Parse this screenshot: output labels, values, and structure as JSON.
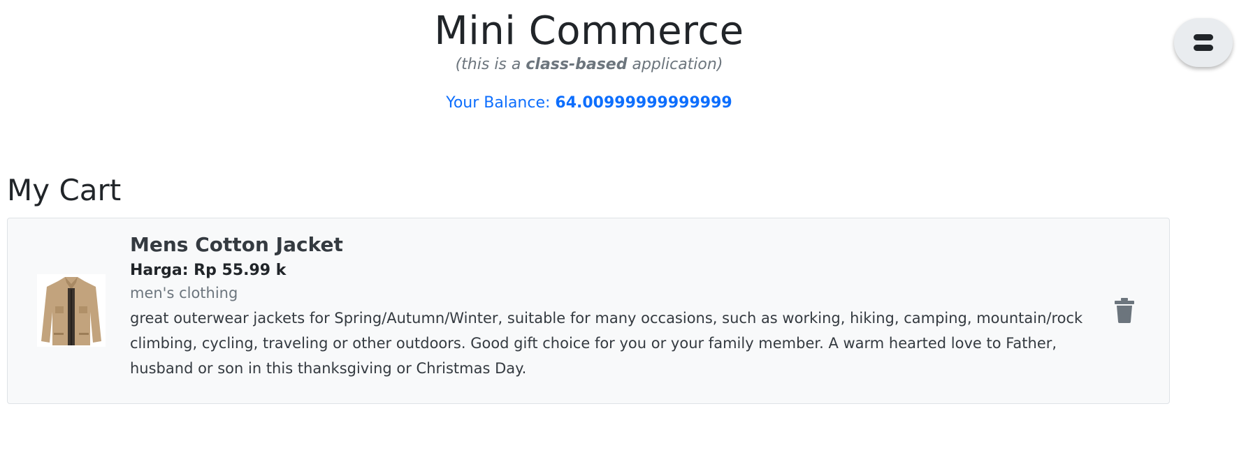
{
  "header": {
    "title": "Mini Commerce",
    "subtitle_prefix": "(this is a ",
    "subtitle_bold": "class-based",
    "subtitle_suffix": " application)",
    "balance_label": "Your Balance: ",
    "balance_value": "64.00999999999999"
  },
  "menu": {
    "icon": "menu-icon"
  },
  "cart": {
    "title": "My Cart",
    "items": [
      {
        "name": "Mens Cotton Jacket",
        "price": "Harga: Rp 55.99 k",
        "category": "men's clothing",
        "description": "great outerwear jackets for Spring/Autumn/Winter, suitable for many occasions, such as working, hiking, camping, mountain/rock climbing, cycling, traveling or other outdoors. Good gift choice for you or your family member. A warm hearted love to Father, husband or son in this thanksgiving or Christmas Day.",
        "image": "jacket-image",
        "delete_icon": "trash-icon"
      }
    ]
  },
  "colors": {
    "accent": "#0d6efd",
    "muted": "#6c757d",
    "card_bg": "#f8f9fa"
  }
}
